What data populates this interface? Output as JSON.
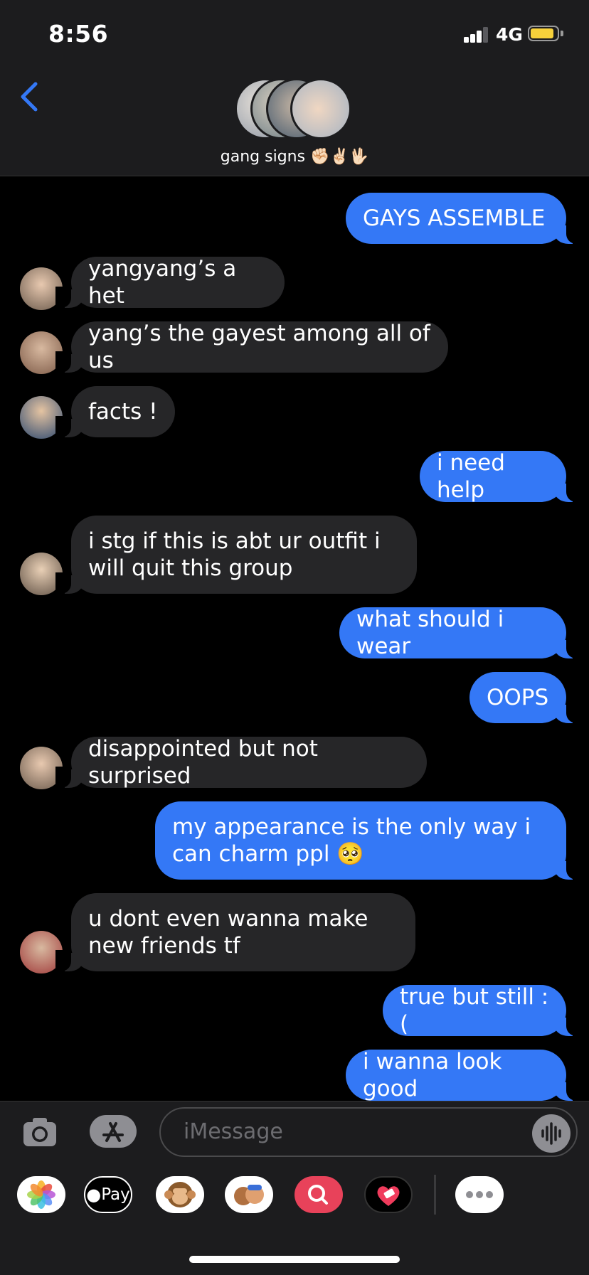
{
  "status_bar": {
    "time": "8:56",
    "network": "4G",
    "battery_level": 0.8,
    "signal_bars": 3
  },
  "header": {
    "group_name": "gang signs ✊🏻✌🏻🖖🏻",
    "icons": [
      "back-chevron-icon"
    ]
  },
  "messages": [
    {
      "side": "out",
      "text": "GAYS ASSEMBLE"
    },
    {
      "side": "in",
      "text": "yangyang’s a het",
      "avatar": true
    },
    {
      "side": "in",
      "text": "yang’s the gayest among all of us",
      "avatar": true
    },
    {
      "side": "in",
      "text": "facts !",
      "avatar": true
    },
    {
      "side": "out",
      "text": "i need help"
    },
    {
      "side": "in",
      "text": "i stg if this is abt ur outfit i will quit this group",
      "avatar": true
    },
    {
      "side": "out",
      "text": "what should i wear"
    },
    {
      "side": "out",
      "text": "OOPS"
    },
    {
      "side": "in",
      "text": "disappointed but not surprised",
      "avatar": true
    },
    {
      "side": "out",
      "text": "my appearance is the only way i can charm ppl 🥺"
    },
    {
      "side": "in",
      "text": "u dont even wanna make new friends tf",
      "avatar": true
    },
    {
      "side": "out",
      "text": "true but still :("
    },
    {
      "side": "out",
      "text": "i wanna look good"
    }
  ],
  "composer": {
    "placeholder": "iMessage",
    "icons": [
      "camera-icon",
      "app-store-icon",
      "audio-waveform-icon"
    ]
  },
  "app_drawer": {
    "items": [
      {
        "name": "photos-app-icon",
        "label": ""
      },
      {
        "name": "apple-pay-app-icon",
        "label": "Pay"
      },
      {
        "name": "animoji-monkey-icon",
        "label": ""
      },
      {
        "name": "memoji-icon",
        "label": ""
      },
      {
        "name": "web-search-icon",
        "label": ""
      },
      {
        "name": "digital-touch-icon",
        "label": ""
      },
      {
        "name": "more-apps-icon",
        "label": ""
      }
    ]
  },
  "colors": {
    "outgoing": "#3478f6",
    "incoming": "#262628",
    "background": "#000000",
    "bar": "#1c1c1e"
  }
}
